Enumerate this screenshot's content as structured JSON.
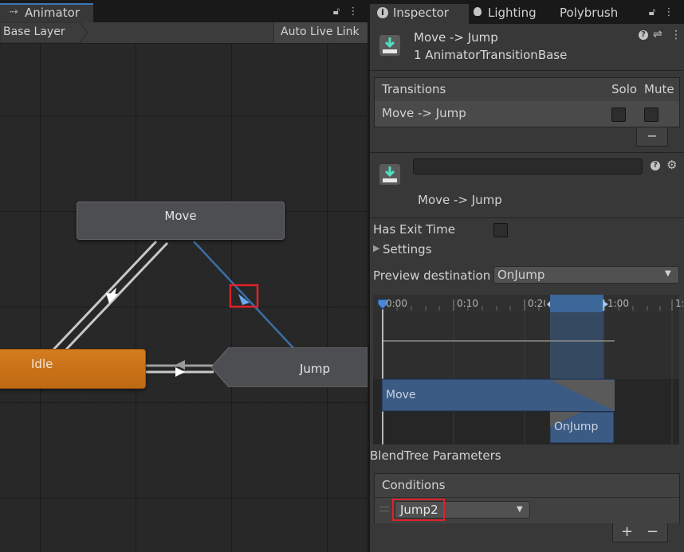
{
  "animator": {
    "tab_label": "Animator",
    "breadcrumb": "Base Layer",
    "auto_live_link": "Auto Live Link",
    "states": {
      "move": "Move",
      "idle": "Idle",
      "jump": "Jump"
    }
  },
  "tabs": {
    "inspector": "Inspector",
    "lighting": "Lighting",
    "polybrush": "Polybrush"
  },
  "inspector": {
    "title": "Move -> Jump",
    "subtitle": "1 AnimatorTransitionBase",
    "transitions": {
      "header": "Transitions",
      "solo": "Solo",
      "mute": "Mute",
      "rows": [
        {
          "label": "Move -> Jump"
        }
      ],
      "minus": "−"
    },
    "transition": {
      "name_value": "",
      "label": "Move -> Jump",
      "has_exit_time_label": "Has Exit Time",
      "settings_label": "Settings",
      "preview_destination_label": "Preview destination",
      "preview_destination_value": "OnJump"
    },
    "timeline": {
      "ticks": [
        "0:00",
        "0:10",
        "0:20",
        "1:00",
        "1:"
      ],
      "move_clip": "Move",
      "onjump_clip": "OnJump"
    },
    "blendtree_label": "BlendTree Parameters",
    "conditions": {
      "header": "Conditions",
      "param": "Jump2",
      "plus": "+",
      "minus": "−"
    }
  }
}
